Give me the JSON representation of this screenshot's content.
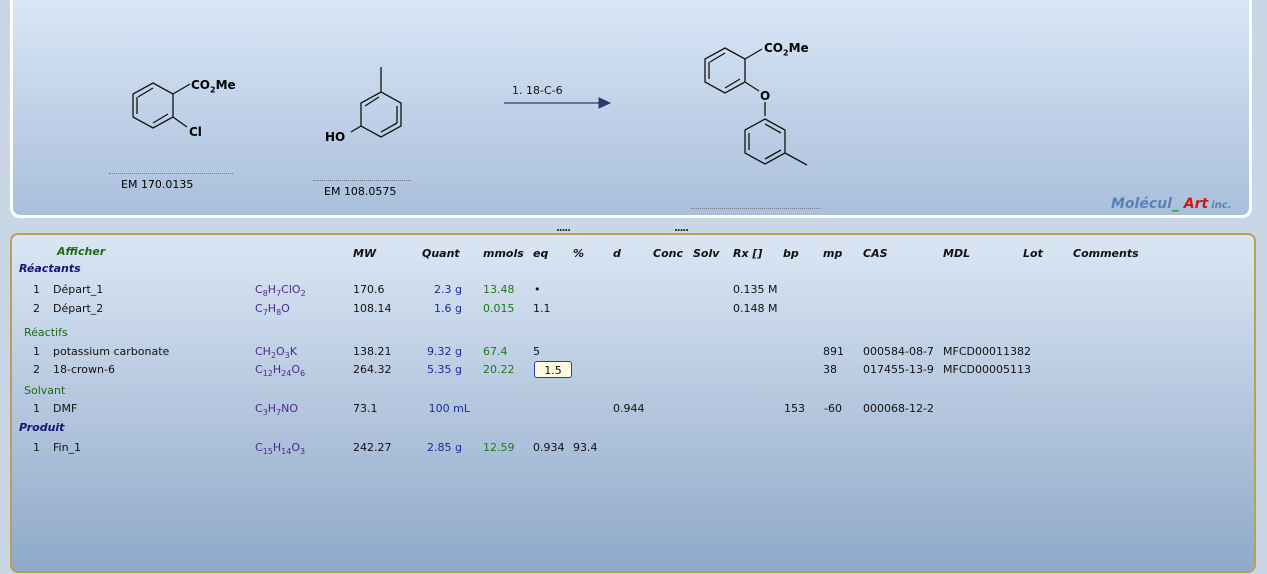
{
  "scheme": {
    "reactant1": {
      "substituent_top": "CO",
      "sub_top": "2",
      "substituent_top2": "Me",
      "substituent_bottom": "Cl",
      "em": "EM 170.0135"
    },
    "reactant2": {
      "substituent_oh": "HO",
      "em": "EM 108.0575"
    },
    "arrow_label": "1. 18-C-6",
    "product": {
      "substituent_top": "CO",
      "sub_top": "2",
      "substituent_top2": "Me",
      "oxygen": "O"
    },
    "logo": {
      "part1": "Molécul",
      "underscore": "_",
      "part2": "Art",
      "inc": "inc."
    },
    "handle_left": ".....",
    "handle_right": "....."
  },
  "table": {
    "headers": {
      "afficher": "Afficher",
      "mw": "MW",
      "quant": "Quant",
      "mmols": "mmols",
      "eq": "eq",
      "pct": "%",
      "d": "d",
      "conc": "Conc",
      "solv": "Solv",
      "rx": "Rx []",
      "bp": "bp",
      "mp": "mp",
      "cas": "CAS",
      "mdl": "MDL",
      "lot": "Lot",
      "comments": "Comments"
    },
    "sections": {
      "reactants": "Réactants",
      "reagents": "Réactifs",
      "solvent": "Solvant",
      "product": "Produit"
    },
    "reactants": [
      {
        "n": "1",
        "name": "Départ_1",
        "formula": [
          [
            "C",
            "8"
          ],
          [
            "H",
            "7"
          ],
          [
            "ClO",
            "2"
          ]
        ],
        "mw": "170.6",
        "quant": "2.3 g",
        "mmols": "13.48",
        "eq": "•",
        "rx": "0.135 M"
      },
      {
        "n": "2",
        "name": "Départ_2",
        "formula": [
          [
            "C",
            "7"
          ],
          [
            "H",
            "8"
          ],
          [
            "O",
            ""
          ]
        ],
        "mw": "108.14",
        "quant": "1.6 g",
        "mmols": "0.015",
        "eq": "1.1",
        "rx": "0.148 M"
      }
    ],
    "reagents": [
      {
        "n": "1",
        "name": "potassium carbonate",
        "formula": [
          [
            "CH",
            "2"
          ],
          [
            "O",
            "3"
          ],
          [
            "K",
            ""
          ]
        ],
        "mw": "138.21",
        "quant": "9.32 g",
        "mmols": "67.4",
        "eq": "5",
        "mp": "891",
        "cas": "000584-08-7",
        "mdl": "MFCD00011382"
      },
      {
        "n": "2",
        "name": "18-crown-6",
        "formula": [
          [
            "C",
            "12"
          ],
          [
            "H",
            "24"
          ],
          [
            "O",
            "6"
          ]
        ],
        "mw": "264.32",
        "quant": "5.35 g",
        "mmols": "20.22",
        "eq": "1.5",
        "mp": "38",
        "cas": "017455-13-9",
        "mdl": "MFCD00005113"
      }
    ],
    "solvents": [
      {
        "n": "1",
        "name": "DMF",
        "formula": [
          [
            "C",
            "3"
          ],
          [
            "H",
            "7"
          ],
          [
            "NO",
            ""
          ]
        ],
        "mw": "73.1",
        "quant": "100 mL",
        "d": "0.944",
        "bp": "153",
        "mp": "-60",
        "cas": "000068-12-2"
      }
    ],
    "products": [
      {
        "n": "1",
        "name": "Fin_1",
        "formula": [
          [
            "C",
            "15"
          ],
          [
            "H",
            "14"
          ],
          [
            "O",
            "3"
          ]
        ],
        "mw": "242.27",
        "quant": "2.85 g",
        "mmols": "12.59",
        "eq": "0.934",
        "pct": "93.4"
      }
    ]
  }
}
